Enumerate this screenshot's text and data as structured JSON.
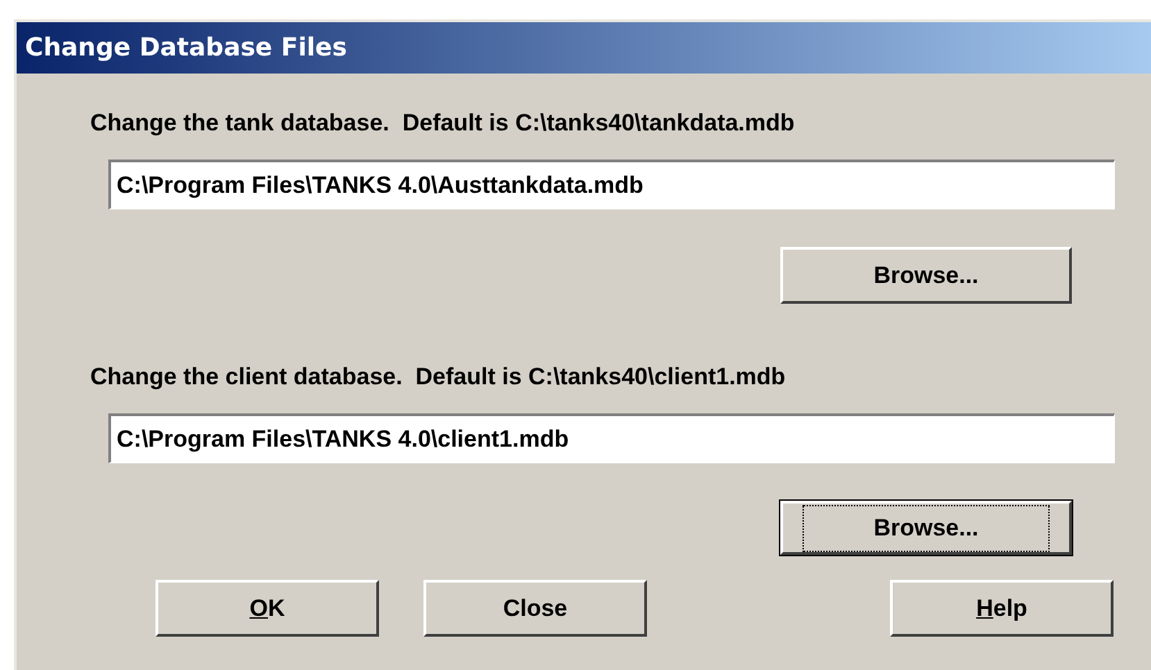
{
  "window": {
    "title": "Change Database Files"
  },
  "sections": [
    {
      "label": "Change the tank database.  Default is C:\\tanks40\\tankdata.mdb",
      "value": "C:\\Program Files\\TANKS 4.0\\Austtankdata.mdb",
      "button": {
        "label": "Browse...",
        "focused": false
      }
    },
    {
      "label": "Change the client database.  Default is C:\\tanks40\\client1.mdb",
      "value": "C:\\Program Files\\TANKS 4.0\\client1.mdb",
      "button": {
        "label": "Browse...",
        "focused": true
      }
    }
  ],
  "buttons": [
    {
      "label": "OK",
      "first_letter_underlined": true
    },
    {
      "label": "Close",
      "first_letter_underlined": false
    },
    {
      "label": "Help",
      "first_letter_underlined": true
    }
  ]
}
